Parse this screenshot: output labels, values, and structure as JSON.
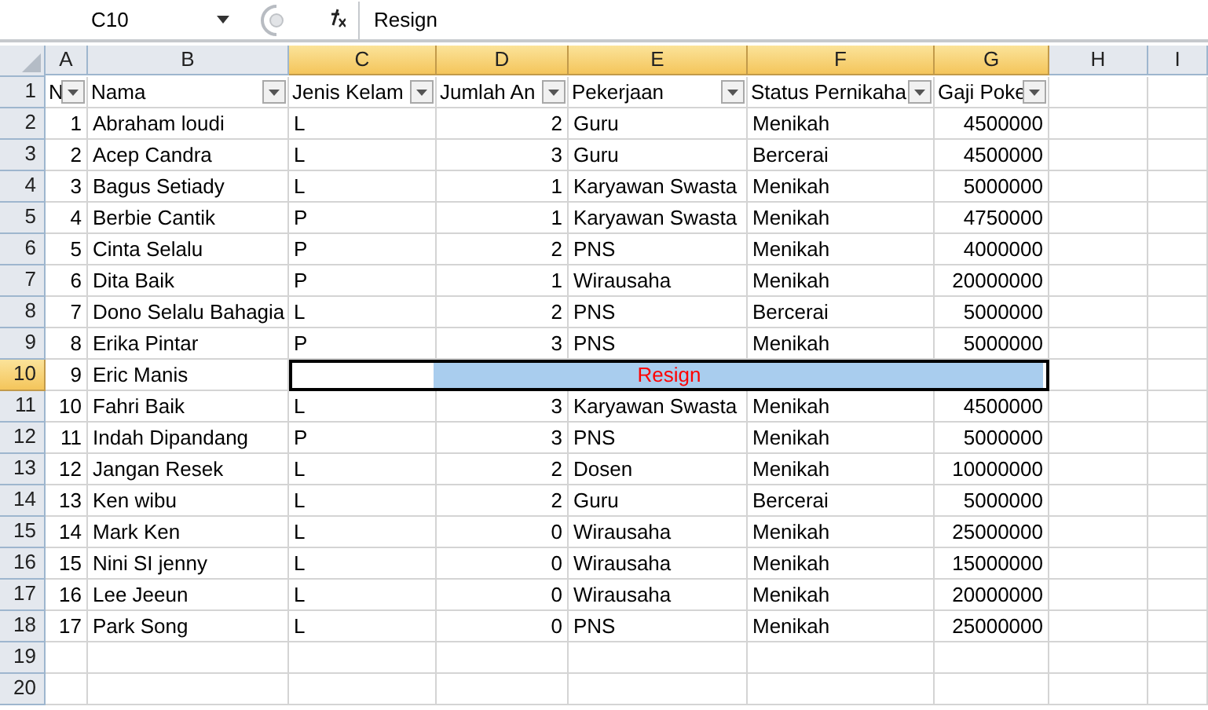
{
  "name_box": "C10",
  "formula": "Resign",
  "columns": [
    {
      "label": "A",
      "selected": false
    },
    {
      "label": "B",
      "selected": false
    },
    {
      "label": "C",
      "selected": true
    },
    {
      "label": "D",
      "selected": true
    },
    {
      "label": "E",
      "selected": true
    },
    {
      "label": "F",
      "selected": true
    },
    {
      "label": "G",
      "selected": true
    },
    {
      "label": "H",
      "selected": false
    },
    {
      "label": "I",
      "selected": false
    }
  ],
  "header_row": {
    "row": "1",
    "selected": false,
    "cells": [
      "N",
      "Nama",
      "Jenis Kelam",
      "Jumlah An",
      "Pekerjaan",
      "Status Pernikaha",
      "Gaji Poke"
    ]
  },
  "rows": [
    {
      "row": "2",
      "selected": false,
      "cells": [
        "1",
        "Abraham loudi",
        "L",
        "2",
        "Guru",
        "Menikah",
        "4500000"
      ]
    },
    {
      "row": "3",
      "selected": false,
      "cells": [
        "2",
        "Acep Candra",
        "L",
        "3",
        "Guru",
        "Bercerai",
        "4500000"
      ]
    },
    {
      "row": "4",
      "selected": false,
      "cells": [
        "3",
        "Bagus Setiady",
        "L",
        "1",
        "Karyawan Swasta",
        "Menikah",
        "5000000"
      ]
    },
    {
      "row": "5",
      "selected": false,
      "cells": [
        "4",
        "Berbie Cantik",
        "P",
        "1",
        "Karyawan Swasta",
        "Menikah",
        "4750000"
      ]
    },
    {
      "row": "6",
      "selected": false,
      "cells": [
        "5",
        "Cinta Selalu",
        "P",
        "2",
        "PNS",
        "Menikah",
        "4000000"
      ]
    },
    {
      "row": "7",
      "selected": false,
      "cells": [
        "6",
        "Dita Baik",
        "P",
        "1",
        "Wirausaha",
        "Menikah",
        "20000000"
      ]
    },
    {
      "row": "8",
      "selected": false,
      "cells": [
        "7",
        "Dono Selalu Bahagia",
        "L",
        "2",
        "PNS",
        "Bercerai",
        "5000000"
      ]
    },
    {
      "row": "9",
      "selected": false,
      "cells": [
        "8",
        "Erika Pintar",
        "P",
        "3",
        "PNS",
        "Menikah",
        "5000000"
      ]
    },
    {
      "row": "10",
      "selected": true,
      "cells": [
        "9",
        "Eric Manis"
      ],
      "merged": "Resign"
    },
    {
      "row": "11",
      "selected": false,
      "cells": [
        "10",
        "Fahri Baik",
        "L",
        "3",
        "Karyawan Swasta",
        "Menikah",
        "4500000"
      ]
    },
    {
      "row": "12",
      "selected": false,
      "cells": [
        "11",
        "Indah Dipandang",
        "P",
        "3",
        "PNS",
        "Menikah",
        "5000000"
      ]
    },
    {
      "row": "13",
      "selected": false,
      "cells": [
        "12",
        "Jangan Resek",
        "L",
        "2",
        "Dosen",
        "Menikah",
        "10000000"
      ]
    },
    {
      "row": "14",
      "selected": false,
      "cells": [
        "13",
        "Ken wibu",
        "L",
        "2",
        "Guru",
        "Bercerai",
        "5000000"
      ]
    },
    {
      "row": "15",
      "selected": false,
      "cells": [
        "14",
        "Mark Ken",
        "L",
        "0",
        "Wirausaha",
        "Menikah",
        "25000000"
      ]
    },
    {
      "row": "16",
      "selected": false,
      "cells": [
        "15",
        "Nini SI jenny",
        "L",
        "0",
        "Wirausaha",
        "Menikah",
        "15000000"
      ]
    },
    {
      "row": "17",
      "selected": false,
      "cells": [
        "16",
        "Lee Jeeun",
        "L",
        "0",
        "Wirausaha",
        "Menikah",
        "20000000"
      ]
    },
    {
      "row": "18",
      "selected": false,
      "cells": [
        "17",
        "Park Song",
        "L",
        "0",
        "PNS",
        "Menikah",
        "25000000"
      ]
    },
    {
      "row": "19",
      "selected": false,
      "cells": []
    },
    {
      "row": "20",
      "selected": false,
      "cells": []
    }
  ]
}
